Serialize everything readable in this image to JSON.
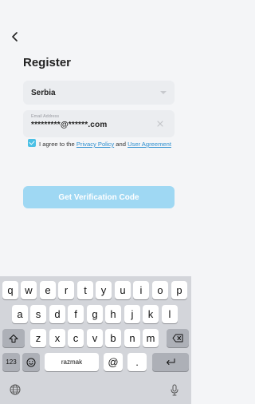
{
  "status_bar": {
    "left": "",
    "right": ""
  },
  "nav": {
    "back_icon": "chevron-left-icon"
  },
  "page": {
    "title": "Register"
  },
  "country": {
    "value": "Serbia",
    "icon": "chevron-down-icon"
  },
  "email": {
    "label": "Email Address",
    "value": "*********@******.com",
    "clear_icon": "close-icon"
  },
  "agreement": {
    "checked": true,
    "text_before": "I agree to the",
    "privacy_link": "Privacy Policy",
    "and": "and",
    "user_link": "User Agreement"
  },
  "actions": {
    "verify_label": "Get Verification Code"
  },
  "keyboard": {
    "row1": [
      "q",
      "w",
      "e",
      "r",
      "t",
      "y",
      "u",
      "i",
      "o",
      "p"
    ],
    "row2": [
      "a",
      "s",
      "d",
      "f",
      "g",
      "h",
      "j",
      "k",
      "l"
    ],
    "row3": [
      "z",
      "x",
      "c",
      "v",
      "b",
      "n",
      "m"
    ],
    "numbers_key": "123",
    "suggestion": "razmak",
    "at_key": "@",
    "dot_key": ".",
    "icons": {
      "shift": "shift-icon",
      "backspace": "backspace-icon",
      "emoji": "emoji-icon",
      "return": "return-icon",
      "globe": "globe-icon",
      "mic": "microphone-icon"
    }
  },
  "colors": {
    "accent": "#4bc0e5",
    "button_disabled": "#9fd8f3",
    "link": "#2c8fd0",
    "keyboard_bg": "#d3d5da"
  }
}
